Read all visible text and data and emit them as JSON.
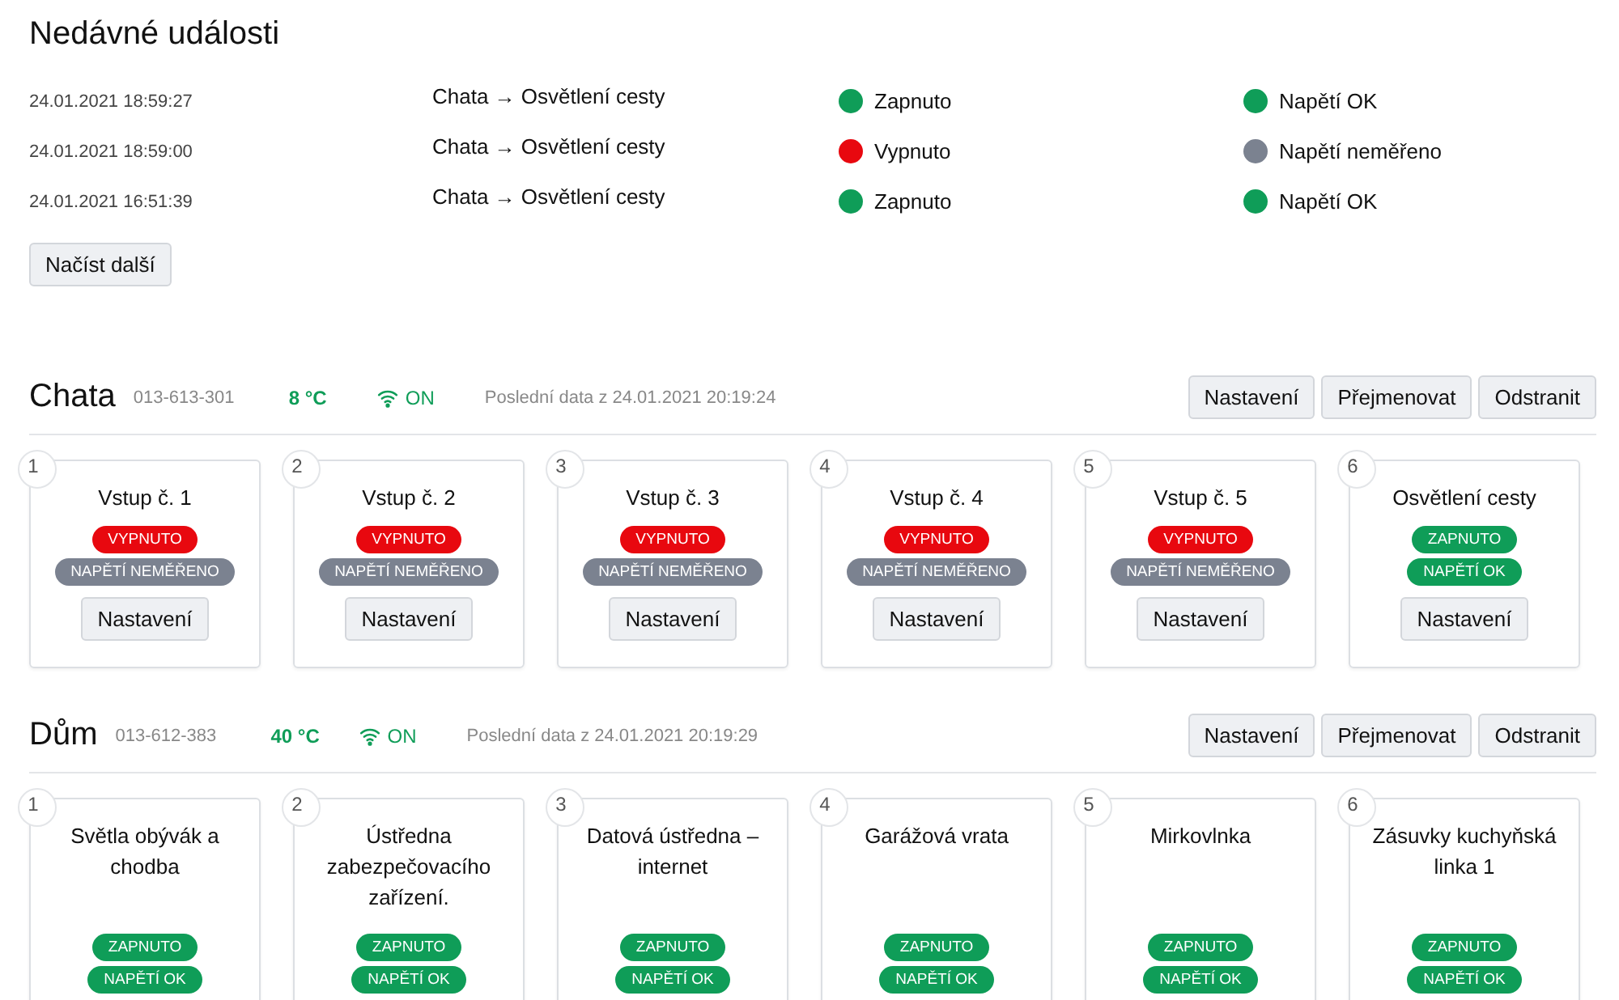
{
  "events": {
    "title": "Nedávné události",
    "rows": [
      {
        "time": "24.01.2021 18:59:27",
        "source": "Chata → Osvětlení cesty",
        "state": {
          "label": "Zapnuto",
          "color": "#0f9d58"
        },
        "voltage": {
          "label": "Napětí OK",
          "color": "#0f9d58"
        }
      },
      {
        "time": "24.01.2021 18:59:00",
        "source": "Chata → Osvětlení cesty",
        "state": {
          "label": "Vypnuto",
          "color": "#e8080f"
        },
        "voltage": {
          "label": "Napětí neměřeno",
          "color": "#7b8290"
        }
      },
      {
        "time": "24.01.2021 16:51:39",
        "source": "Chata → Osvětlení cesty",
        "state": {
          "label": "Zapnuto",
          "color": "#0f9d58"
        },
        "voltage": {
          "label": "Napětí OK",
          "color": "#0f9d58"
        }
      }
    ],
    "load_more": "Načíst další"
  },
  "devices": [
    {
      "name": "Chata",
      "serial": "013-613-301",
      "temperature": "8 °C",
      "connection": "ON",
      "last_data": "Poslední data z 24.01.2021 20:19:24",
      "buttons": [
        "Nastavení",
        "Přejmenovat",
        "Odstranit"
      ],
      "inputs": [
        {
          "number": "1",
          "name": "Vstup č. 1",
          "badges": [
            {
              "label": "VYPNUTO",
              "color": "#e8080f"
            },
            {
              "label": "NAPĚTÍ NEMĚŘENO",
              "color": "#7b8290"
            }
          ],
          "button": "Nastavení"
        },
        {
          "number": "2",
          "name": "Vstup č. 2",
          "badges": [
            {
              "label": "VYPNUTO",
              "color": "#e8080f"
            },
            {
              "label": "NAPĚTÍ NEMĚŘENO",
              "color": "#7b8290"
            }
          ],
          "button": "Nastavení"
        },
        {
          "number": "3",
          "name": "Vstup č. 3",
          "badges": [
            {
              "label": "VYPNUTO",
              "color": "#e8080f"
            },
            {
              "label": "NAPĚTÍ NEMĚŘENO",
              "color": "#7b8290"
            }
          ],
          "button": "Nastavení"
        },
        {
          "number": "4",
          "name": "Vstup č. 4",
          "badges": [
            {
              "label": "VYPNUTO",
              "color": "#e8080f"
            },
            {
              "label": "NAPĚTÍ NEMĚŘENO",
              "color": "#7b8290"
            }
          ],
          "button": "Nastavení"
        },
        {
          "number": "5",
          "name": "Vstup č. 5",
          "badges": [
            {
              "label": "VYPNUTO",
              "color": "#e8080f"
            },
            {
              "label": "NAPĚTÍ NEMĚŘENO",
              "color": "#7b8290"
            }
          ],
          "button": "Nastavení"
        },
        {
          "number": "6",
          "name": "Osvětlení cesty",
          "badges": [
            {
              "label": "ZAPNUTO",
              "color": "#0f9d58"
            },
            {
              "label": "NAPĚTÍ OK",
              "color": "#0f9d58"
            }
          ],
          "button": "Nastavení"
        }
      ]
    },
    {
      "name": "Dům",
      "serial": "013-612-383",
      "temperature": "40 °C",
      "connection": "ON",
      "last_data": "Poslední data z 24.01.2021 20:19:29",
      "buttons": [
        "Nastavení",
        "Přejmenovat",
        "Odstranit"
      ],
      "inputs": [
        {
          "number": "1",
          "name": "Světla obývák a chodba",
          "badges": [
            {
              "label": "ZAPNUTO",
              "color": "#0f9d58"
            },
            {
              "label": "NAPĚTÍ OK",
              "color": "#0f9d58"
            }
          ]
        },
        {
          "number": "2",
          "name": "Ústředna zabezpečovacího zařízení.",
          "badges": [
            {
              "label": "ZAPNUTO",
              "color": "#0f9d58"
            },
            {
              "label": "NAPĚTÍ OK",
              "color": "#0f9d58"
            }
          ]
        },
        {
          "number": "3",
          "name": "Datová ústředna – internet",
          "badges": [
            {
              "label": "ZAPNUTO",
              "color": "#0f9d58"
            },
            {
              "label": "NAPĚTÍ OK",
              "color": "#0f9d58"
            }
          ]
        },
        {
          "number": "4",
          "name": "Garážová vrata",
          "badges": [
            {
              "label": "ZAPNUTO",
              "color": "#0f9d58"
            },
            {
              "label": "NAPĚTÍ OK",
              "color": "#0f9d58"
            }
          ]
        },
        {
          "number": "5",
          "name": "Mirkovlnka",
          "badges": [
            {
              "label": "ZAPNUTO",
              "color": "#0f9d58"
            },
            {
              "label": "NAPĚTÍ OK",
              "color": "#0f9d58"
            }
          ]
        },
        {
          "number": "6",
          "name": "Zásuvky kuchyňská linka 1",
          "badges": [
            {
              "label": "ZAPNUTO",
              "color": "#0f9d58"
            },
            {
              "label": "NAPĚTÍ OK",
              "color": "#0f9d58"
            }
          ]
        }
      ]
    }
  ]
}
